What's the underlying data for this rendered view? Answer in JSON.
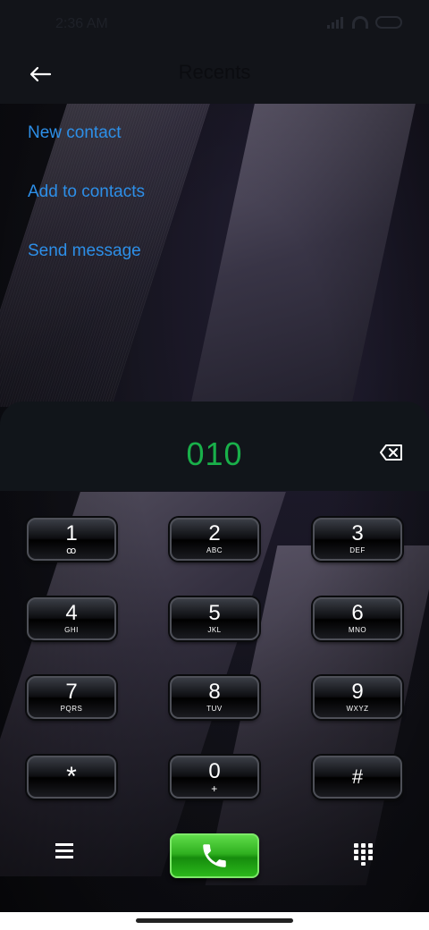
{
  "status_bar": {
    "time": "2:36 AM"
  },
  "header": {
    "title": "Recents",
    "back_icon": "arrow-left-icon"
  },
  "actions": [
    {
      "label": "New contact"
    },
    {
      "label": "Add to contacts"
    },
    {
      "label": "Send message"
    }
  ],
  "dial": {
    "number": "010",
    "backspace_icon": "backspace-icon",
    "number_color": "#19b04a"
  },
  "keypad": [
    {
      "digit": "1",
      "letters": "ꝏ"
    },
    {
      "digit": "2",
      "letters": "ABC"
    },
    {
      "digit": "3",
      "letters": "DEF"
    },
    {
      "digit": "4",
      "letters": "GHI"
    },
    {
      "digit": "5",
      "letters": "JKL"
    },
    {
      "digit": "6",
      "letters": "MNO"
    },
    {
      "digit": "7",
      "letters": "PQRS"
    },
    {
      "digit": "8",
      "letters": "TUV"
    },
    {
      "digit": "9",
      "letters": "WXYZ"
    },
    {
      "digit": "*",
      "letters": ""
    },
    {
      "digit": "0",
      "letters": "+"
    },
    {
      "digit": "#",
      "letters": ""
    }
  ],
  "bottom_bar": {
    "menu_icon": "menu-icon",
    "call_icon": "phone-icon",
    "keypad_icon": "dialpad-icon"
  },
  "colors": {
    "accent": "#2d8fe8",
    "call_green": "#2fb01f"
  }
}
